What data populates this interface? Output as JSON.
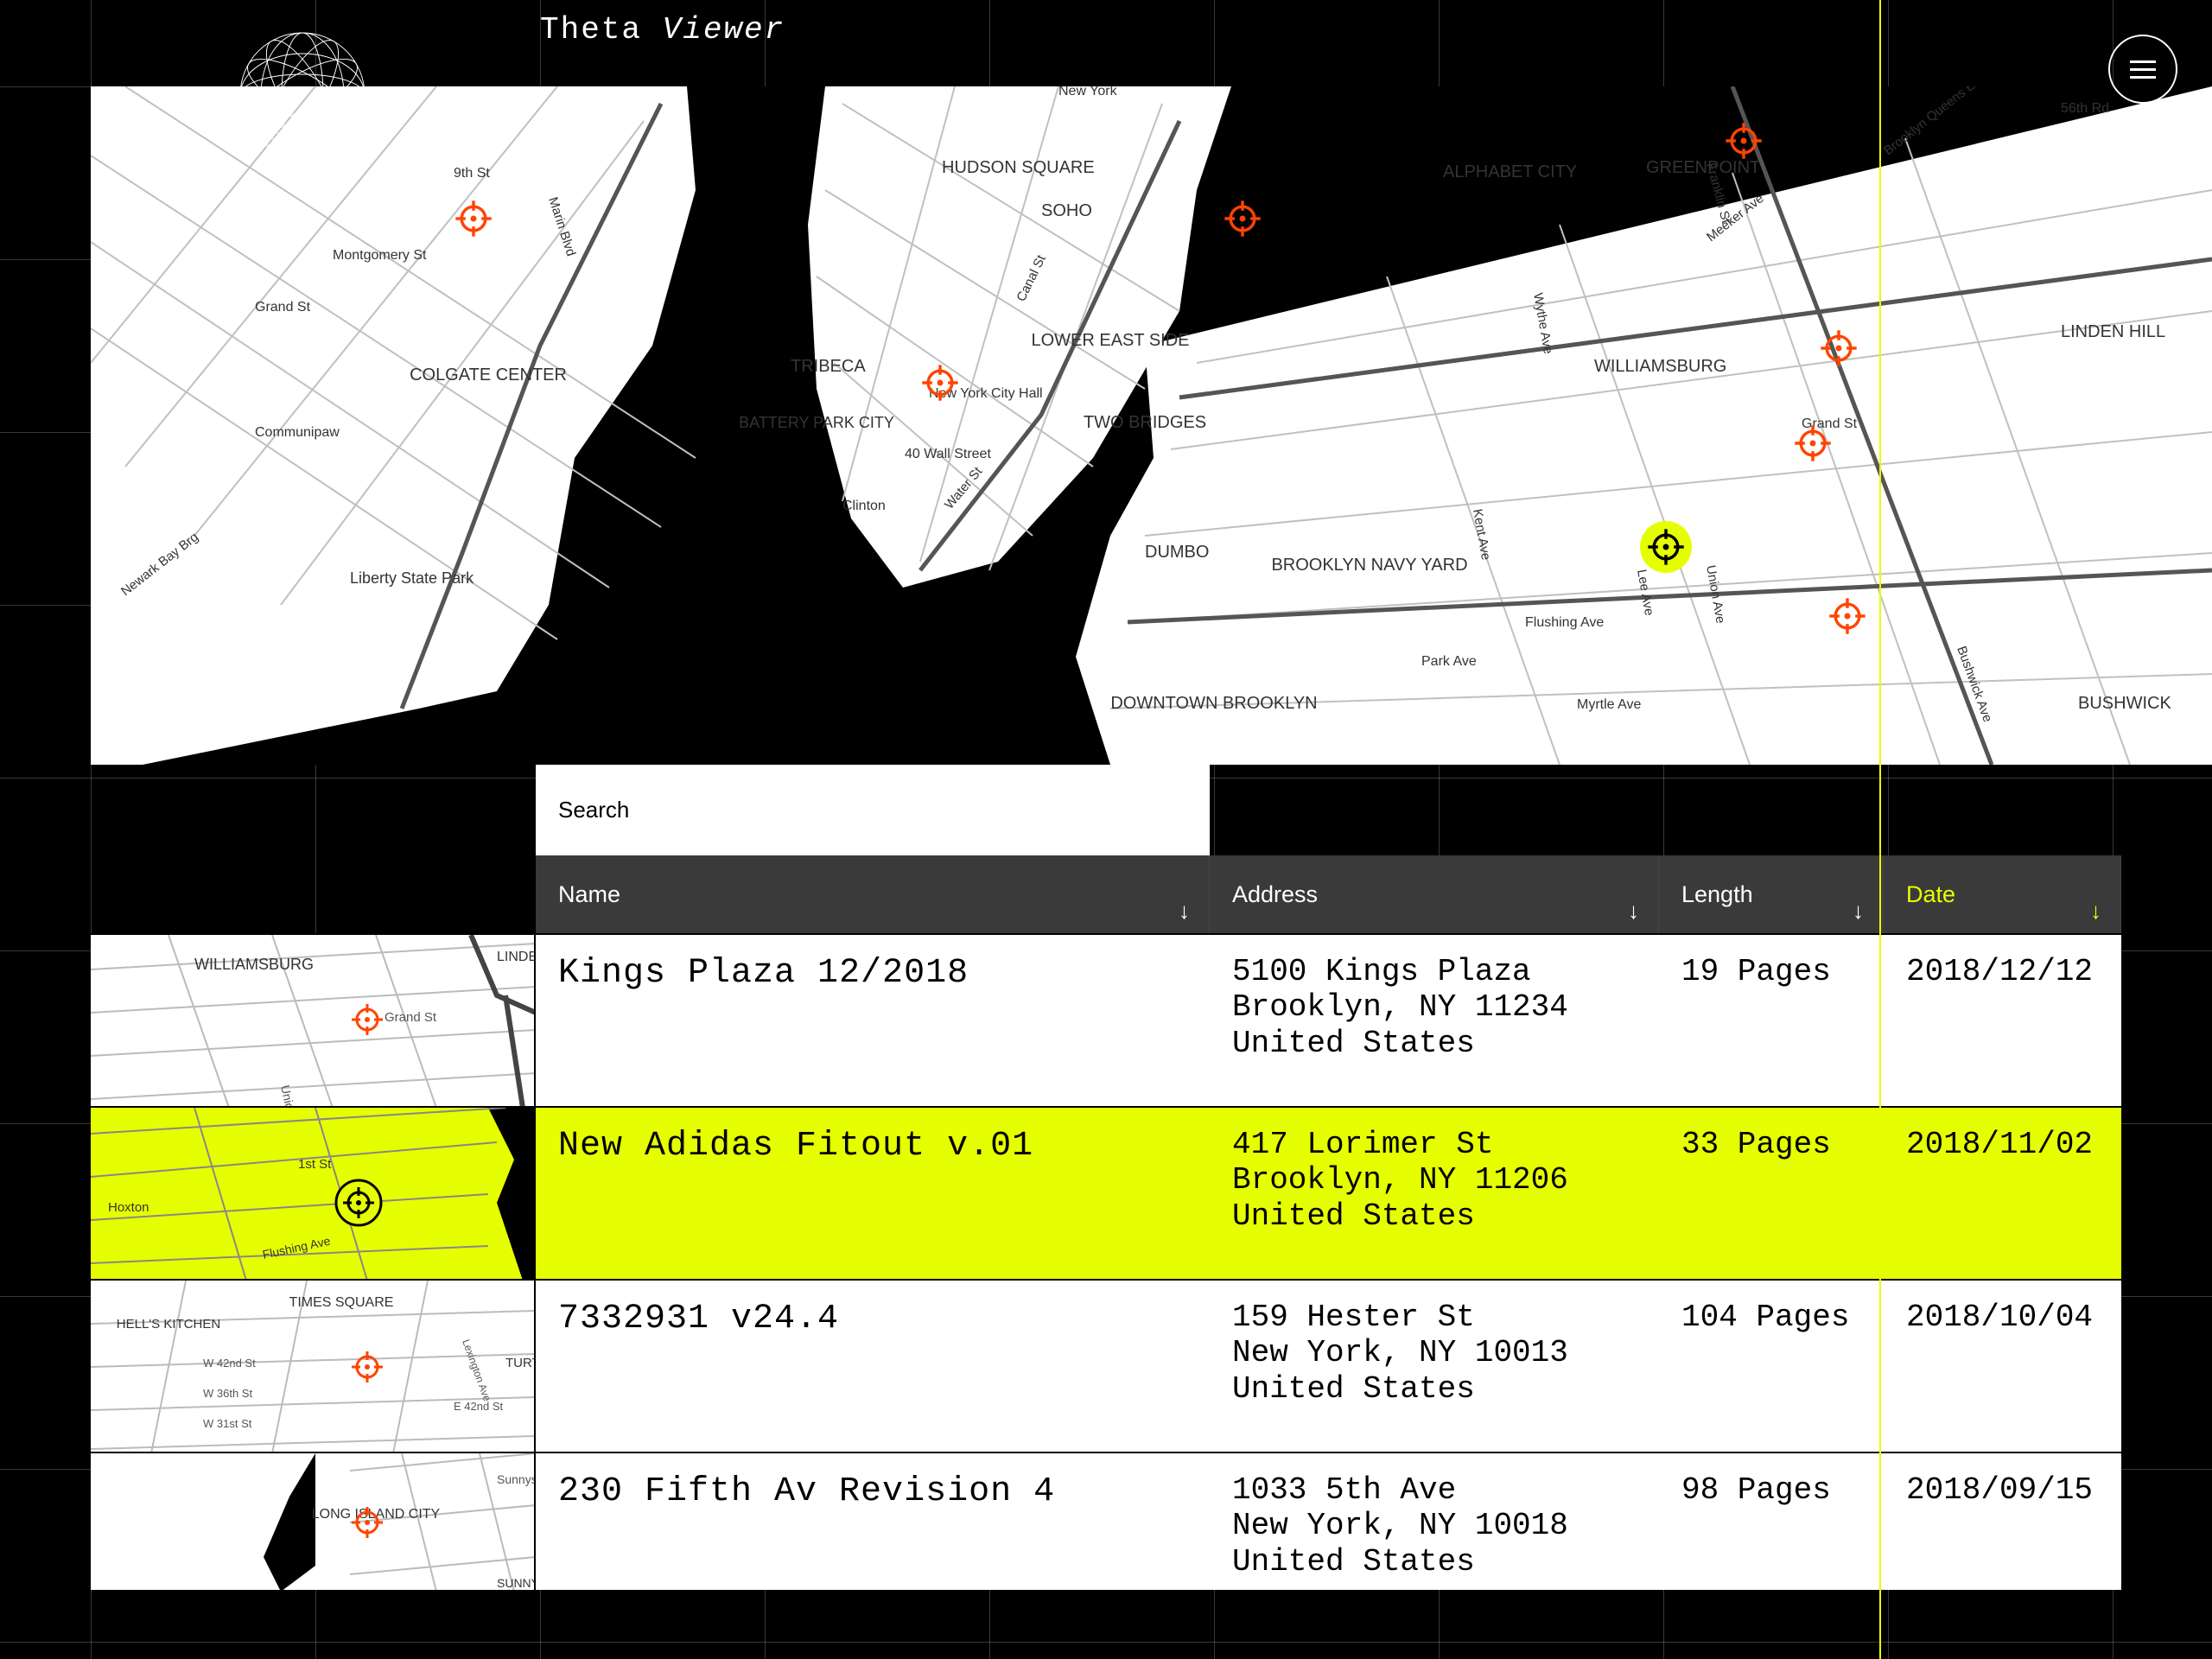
{
  "app": {
    "title_word1": "Theta",
    "title_word2": "Viewer"
  },
  "search": {
    "label": "Search"
  },
  "columns": {
    "name": {
      "label": "Name"
    },
    "address": {
      "label": "Address"
    },
    "length": {
      "label": "Length"
    },
    "date": {
      "label": "Date"
    }
  },
  "map": {
    "labels": [
      "HUDSON SQUARE",
      "SOHO",
      "ALPHABET CITY",
      "TRIBECA",
      "LOWER EAST SIDE",
      "TWO BRIDGES",
      "DUMBO",
      "BROOKLYN NAVY YARD",
      "DOWNTOWN BROOKLYN",
      "WILLIAMSBURG",
      "GREENPOINT",
      "BUSHWICK",
      "LINDEN HILL",
      "COLGATE CENTER",
      "Liberty State Park",
      "New York City Hall",
      "40 Wall Street",
      "Communipaw",
      "9th St",
      "Montgomery St",
      "Grand St",
      "Canal St",
      "Water St",
      "Clinton",
      "Flushing Ave",
      "Myrtle Ave",
      "Bushwick Ave",
      "Union Ave",
      "Lee Ave",
      "Kent Ave",
      "Grand St",
      "Franklin St",
      "New York",
      "Brooklyn Queens Expy",
      "Marin Blvd",
      "Wythe Ave",
      "Meeker Ave",
      "56th Rd",
      "Newark Bay Brg",
      "Park Ave",
      "BATTERY PARK CITY"
    ],
    "targets": [
      {
        "color": "#ff4400"
      },
      {
        "color": "#ff4400"
      },
      {
        "color": "#ff4400"
      },
      {
        "color": "#ff4400"
      },
      {
        "color": "#ff4400"
      },
      {
        "color": "#ff4400"
      },
      {
        "color": "#ff4400"
      },
      {
        "color": "#e6ff00",
        "selected": true
      }
    ]
  },
  "rows": [
    {
      "name": "Kings Plaza 12/2018",
      "addr_lines": [
        "5100 Kings Plaza",
        "Brooklyn, NY 11234",
        "United States"
      ],
      "length": "19 Pages",
      "date": "2018/12/12",
      "thumb_labels": [
        "WILLIAMSBURG",
        "Grand St",
        "Union Ave",
        "LINDEN HILL"
      ],
      "selected": false
    },
    {
      "name": "New Adidas Fitout v.01",
      "addr_lines": [
        "417 Lorimer St",
        "Brooklyn, NY 11206",
        "United States"
      ],
      "length": "33 Pages",
      "date": "2018/11/02",
      "thumb_labels": [
        "1st St",
        "Hoxton",
        "Flushing Ave"
      ],
      "selected": true
    },
    {
      "name": "7332931 v24.4",
      "addr_lines": [
        "159 Hester St",
        "New York, NY 10013",
        "United States"
      ],
      "length": "104 Pages",
      "date": "2018/10/04",
      "thumb_labels": [
        "HELL'S KITCHEN",
        "TIMES SQUARE",
        "TURTLE",
        "W 36th St",
        "W 42nd St",
        "W 31st St",
        "Lexington Ave",
        "E 42nd St"
      ],
      "selected": false
    },
    {
      "name": "230 Fifth Av Revision 4",
      "addr_lines": [
        "1033 5th Ave",
        "New York, NY 10018",
        "United States"
      ],
      "length": "98 Pages",
      "date": "2018/09/15",
      "thumb_labels": [
        "LONG ISLAND CITY",
        "Sunnyside",
        "SUNNY"
      ],
      "selected": false
    }
  ]
}
